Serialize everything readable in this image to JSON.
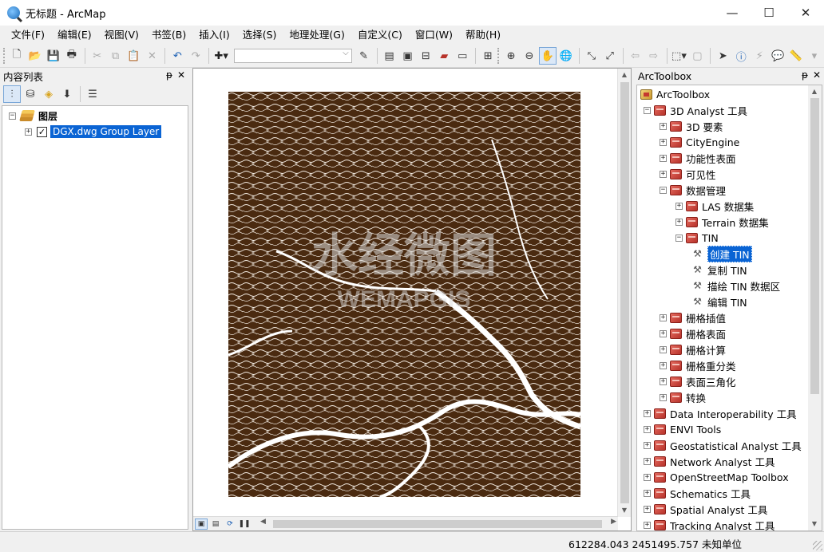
{
  "window": {
    "title": "无标题 - ArcMap",
    "controls": {
      "minimize": "—",
      "maximize": "☐",
      "close": "✕"
    }
  },
  "menu": [
    "文件(F)",
    "编辑(E)",
    "视图(V)",
    "书签(B)",
    "插入(I)",
    "选择(S)",
    "地理处理(G)",
    "自定义(C)",
    "窗口(W)",
    "帮助(H)"
  ],
  "toolbar": {
    "scale_value": "",
    "icons": [
      "new-doc-icon",
      "open-folder-icon",
      "save-icon",
      "print-icon",
      "cut-icon",
      "copy-icon",
      "paste-icon",
      "delete-icon",
      "undo-icon",
      "redo-icon",
      "add-data-icon",
      "editor-icon",
      "toc-window-icon",
      "catalog-icon",
      "search-window-icon",
      "arctoolbox-icon",
      "python-window-icon",
      "model-builder-icon",
      "zoom-in-icon",
      "zoom-out-icon",
      "pan-icon",
      "full-extent-icon",
      "fixed-zoom-in-icon",
      "fixed-zoom-out-icon",
      "back-icon",
      "forward-icon",
      "select-features-icon",
      "clear-selection-icon",
      "select-elements-icon",
      "identify-icon",
      "hyperlink-icon",
      "html-popup-icon",
      "measure-icon"
    ]
  },
  "toc": {
    "title": "内容列表",
    "pin": "ᵽ",
    "close": "✕",
    "root_label": "图层",
    "layer_label": "DGX.dwg Group Layer",
    "layer_checked": "✓"
  },
  "map": {
    "watermark_cn": "水经微图",
    "watermark_en": "WEMAPGIS",
    "line_color": "#4a2a10"
  },
  "toolbox": {
    "title": "ArcToolbox",
    "pin": "ᵽ",
    "close": "✕",
    "items": [
      {
        "label": "ArcToolbox",
        "kind": "root",
        "exp": ""
      },
      {
        "label": "3D Analyst 工具",
        "kind": "box",
        "exp": "−"
      },
      {
        "label": "3D 要素",
        "kind": "box",
        "exp": "+"
      },
      {
        "label": "CityEngine",
        "kind": "box",
        "exp": "+"
      },
      {
        "label": "功能性表面",
        "kind": "box",
        "exp": "+"
      },
      {
        "label": "可见性",
        "kind": "box",
        "exp": "+"
      },
      {
        "label": "数据管理",
        "kind": "box",
        "exp": "−"
      },
      {
        "label": "LAS 数据集",
        "kind": "box",
        "exp": "+"
      },
      {
        "label": "Terrain 数据集",
        "kind": "box",
        "exp": "+"
      },
      {
        "label": "TIN",
        "kind": "box",
        "exp": "−"
      },
      {
        "label": "创建 TIN",
        "kind": "tool",
        "exp": "",
        "selected": true
      },
      {
        "label": "复制 TIN",
        "kind": "tool",
        "exp": ""
      },
      {
        "label": "描绘 TIN 数据区",
        "kind": "tool",
        "exp": ""
      },
      {
        "label": "编辑 TIN",
        "kind": "tool",
        "exp": ""
      },
      {
        "label": "栅格插值",
        "kind": "box",
        "exp": "+"
      },
      {
        "label": "栅格表面",
        "kind": "box",
        "exp": "+"
      },
      {
        "label": "栅格计算",
        "kind": "box",
        "exp": "+"
      },
      {
        "label": "栅格重分类",
        "kind": "box",
        "exp": "+"
      },
      {
        "label": "表面三角化",
        "kind": "box",
        "exp": "+"
      },
      {
        "label": "转换",
        "kind": "box",
        "exp": "+"
      },
      {
        "label": "Data Interoperability 工具",
        "kind": "box",
        "exp": "+"
      },
      {
        "label": "ENVI Tools",
        "kind": "box",
        "exp": "+"
      },
      {
        "label": "Geostatistical Analyst 工具",
        "kind": "box",
        "exp": "+"
      },
      {
        "label": "Network Analyst 工具",
        "kind": "box",
        "exp": "+"
      },
      {
        "label": "OpenStreetMap Toolbox",
        "kind": "box",
        "exp": "+"
      },
      {
        "label": "Schematics 工具",
        "kind": "box",
        "exp": "+"
      },
      {
        "label": "Spatial Analyst 工具",
        "kind": "box",
        "exp": "+"
      },
      {
        "label": "Tracking Analyst 工具",
        "kind": "box",
        "exp": "+"
      }
    ]
  },
  "status": {
    "coords": "612284.043   2451495.757 未知单位"
  }
}
